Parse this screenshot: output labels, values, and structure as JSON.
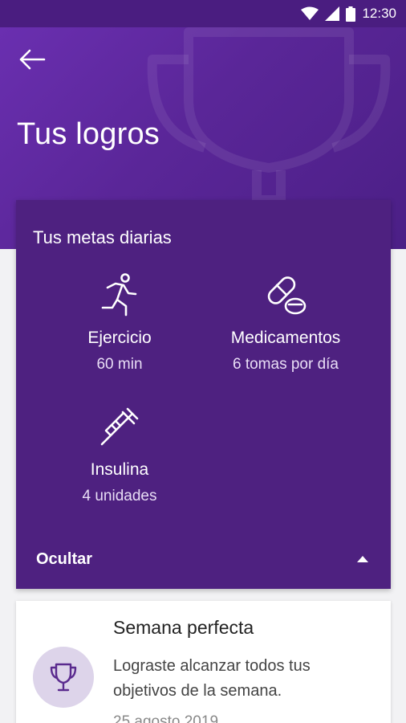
{
  "status_bar": {
    "time": "12:30"
  },
  "header": {
    "title": "Tus logros"
  },
  "goals": {
    "title": "Tus metas diarias",
    "items": [
      {
        "name": "Ejercicio",
        "value": "60 min",
        "icon": "running-person-icon"
      },
      {
        "name": "Medicamentos",
        "value": "6 tomas por día",
        "icon": "pills-icon"
      },
      {
        "name": "Insulina",
        "value": "4 unidades",
        "icon": "syringe-icon"
      }
    ],
    "toggle_label": "Ocultar"
  },
  "achievement": {
    "title": "Semana perfecta",
    "description": "Lograste alcanzar todos tus objetivos de la semana.",
    "date": "25 agosto 2019",
    "icon": "trophy-icon"
  },
  "colors": {
    "header": "#5a2698",
    "card": "#4e2180",
    "badge": "#ddd4ea"
  }
}
